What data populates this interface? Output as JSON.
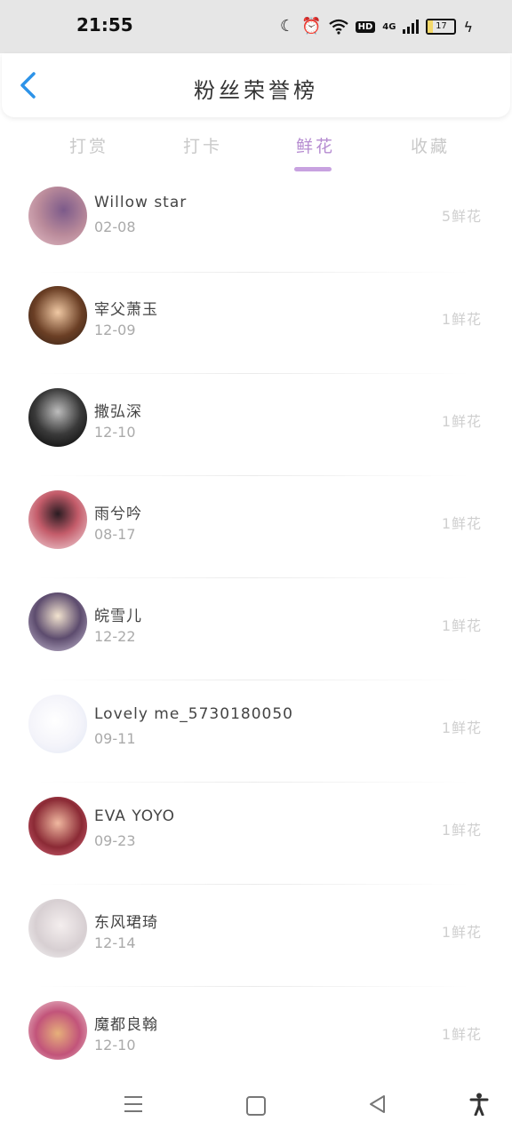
{
  "status": {
    "time": "21:55",
    "network": "4G",
    "battery": "17",
    "battery_level": 0.17
  },
  "header": {
    "title": "粉丝荣誉榜"
  },
  "tabs": [
    {
      "label": "打赏",
      "active": false
    },
    {
      "label": "打卡",
      "active": false
    },
    {
      "label": "鲜花",
      "active": true
    },
    {
      "label": "收藏",
      "active": false
    }
  ],
  "rows": [
    {
      "name": "Willow star",
      "date": "02-08",
      "count": "5鲜花"
    },
    {
      "name": "宰父萧玉",
      "date": "12-09",
      "count": "1鲜花"
    },
    {
      "name": "撒弘深",
      "date": "12-10",
      "count": "1鲜花"
    },
    {
      "name": "雨兮吟",
      "date": "08-17",
      "count": "1鲜花"
    },
    {
      "name": "皖雪儿",
      "date": "12-22",
      "count": "1鲜花"
    },
    {
      "name": "Lovely me_5730180050",
      "date": "09-11",
      "count": "1鲜花"
    },
    {
      "name": "EVA YOYO",
      "date": "09-23",
      "count": "1鲜花"
    },
    {
      "name": "东风珺琦",
      "date": "12-14",
      "count": "1鲜花"
    },
    {
      "name": "魔都良翰",
      "date": "12-10",
      "count": "1鲜花"
    }
  ],
  "colors": {
    "accent": "#b68cd1",
    "back": "#2d93e8",
    "inactive": "#c9c9c9"
  }
}
